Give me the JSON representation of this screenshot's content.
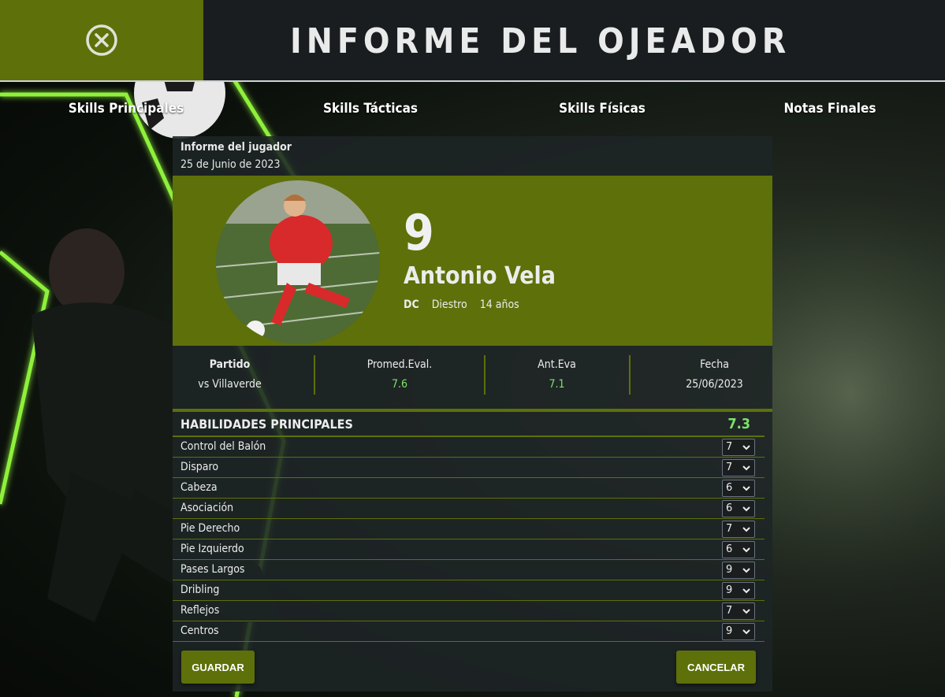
{
  "header": {
    "title": "INFORME DEL OJEADOR",
    "close_icon": "close-circle-icon"
  },
  "tabs": [
    {
      "label": "Skills Principales"
    },
    {
      "label": "Skills Tácticas"
    },
    {
      "label": "Skills Físicas"
    },
    {
      "label": "Notas Finales"
    }
  ],
  "report": {
    "heading": "Informe del jugador",
    "date": "25 de Junio de 2023"
  },
  "player": {
    "number": "9",
    "name": "Antonio Vela",
    "position": "DC",
    "foot": "Diestro",
    "age": "14 años"
  },
  "stats": [
    {
      "label": "Partido",
      "value": "vs Villaverde"
    },
    {
      "label": "Promed.Eval.",
      "value": "7.6"
    },
    {
      "label": "Ant.Eva",
      "value": "7.1"
    },
    {
      "label": "Fecha",
      "value": "25/06/2023"
    }
  ],
  "section": {
    "title": "HABILIDADES PRINCIPALES",
    "score": "7.3"
  },
  "skills": [
    {
      "name": "Control del Balón",
      "value": "7"
    },
    {
      "name": "Disparo",
      "value": "7"
    },
    {
      "name": "Cabeza",
      "value": "6"
    },
    {
      "name": "Asociación",
      "value": "6"
    },
    {
      "name": "Pie Derecho",
      "value": "7"
    },
    {
      "name": "Pie Izquierdo",
      "value": "6"
    },
    {
      "name": "Pases Largos",
      "value": "9"
    },
    {
      "name": "Dribling",
      "value": "9"
    },
    {
      "name": "Reflejos",
      "value": "7"
    },
    {
      "name": "Centros",
      "value": "9"
    }
  ],
  "actions": {
    "save": "GUARDAR",
    "cancel": "CANCELAR"
  },
  "colors": {
    "accent": "#5e7009",
    "highlight": "#7ee36b",
    "neon": "#8ef03a"
  }
}
